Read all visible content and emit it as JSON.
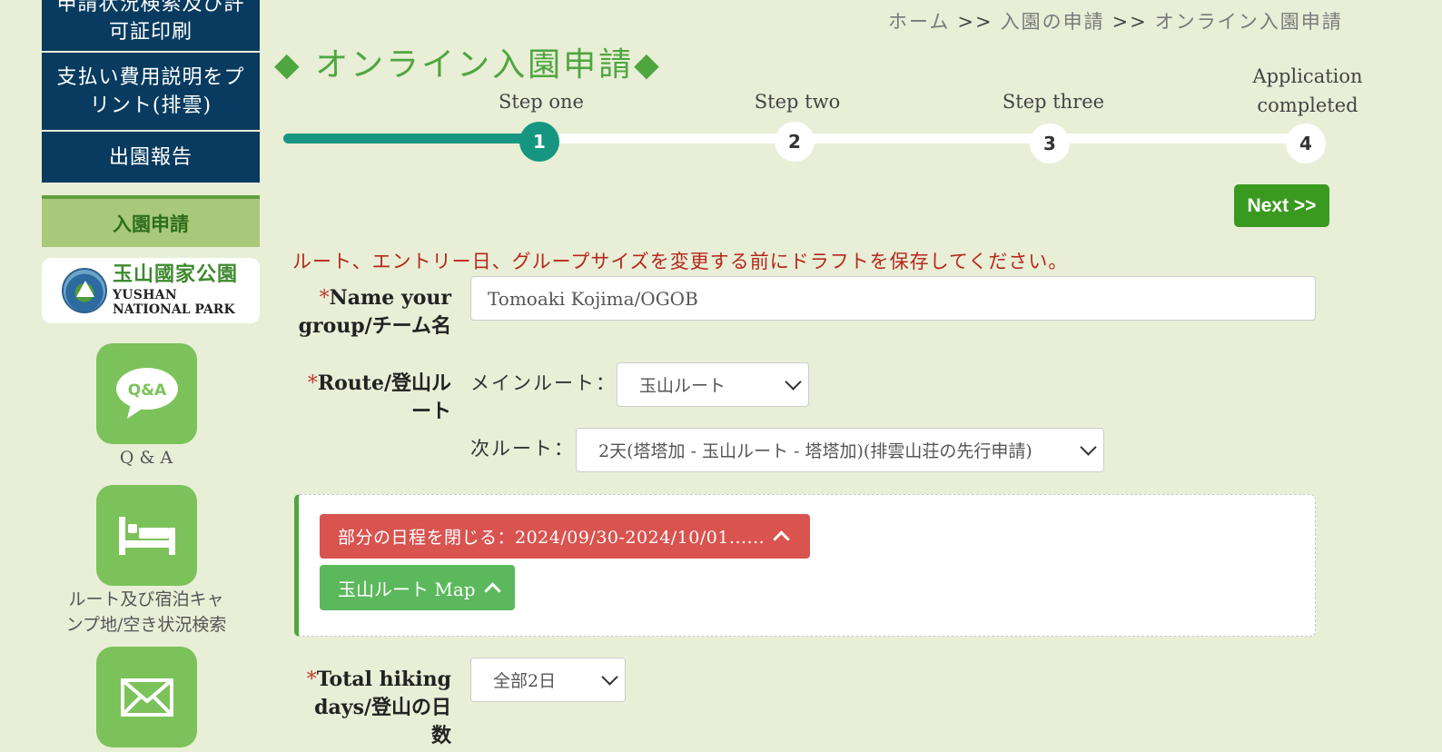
{
  "sidebar": {
    "nav": [
      {
        "label": "申請状況検索及び許可証印刷",
        "line1": "申請状況検索及び許",
        "line2": "可証印刷"
      },
      {
        "label": "支払い費用説明をプリント(排雲)",
        "line1": "支払い費用説明をプ",
        "line2": "リント(排雲)"
      },
      {
        "label": "出園報告"
      }
    ],
    "section_title": "入園申請",
    "logo": {
      "cn": "玉山國家公園",
      "en1": "YUSHAN",
      "en2": "NATIONAL PARK"
    },
    "tiles": [
      {
        "icon": "qa-chat-icon",
        "label": "Q & A",
        "bubble_text": "Q&A"
      },
      {
        "icon": "bed-icon",
        "label_line1": "ルート及び宿泊キャ",
        "label_line2": "ンプ地/空き状況検索"
      },
      {
        "icon": "envelope-icon"
      }
    ]
  },
  "breadcrumb": [
    "ホーム",
    "入園の申請",
    "オンライン入園申請"
  ],
  "breadcrumb_sep": ">>",
  "page_title": "◆ オンライン入園申請◆",
  "steps": [
    {
      "label": "Step one",
      "number": "1",
      "active": true
    },
    {
      "label": "Step two",
      "number": "2",
      "active": false
    },
    {
      "label": "Step three",
      "number": "3",
      "active": false
    },
    {
      "label_line1": "Application",
      "label_line2": "completed",
      "number": "4",
      "active": false
    }
  ],
  "progress_fraction": 0.25,
  "next_button": "Next >>",
  "warning": "ルート、エントリー日、グループサイズを変更する前にドラフトを保存してください。",
  "form": {
    "group_name": {
      "required": "*",
      "label_line1": "Name your",
      "label_line2": "group/チーム名",
      "value": "Tomoaki Kojima/OGOB"
    },
    "route": {
      "required": "*",
      "label_line1": "Route/登山ル",
      "label_line2": "ート",
      "main_label": "メインルート：",
      "main_value": "玉山ルート",
      "sub_label": "次ルート：",
      "sub_value": "2天(塔塔加 - 玉山ルート - 塔塔加)(排雲山荘の先行申請)"
    },
    "schedule_toggle": "部分の日程を閉じる：2024/09/30-2024/10/01......",
    "map_toggle": "玉山ルート Map",
    "hiking_days": {
      "required": "*",
      "label_line1": "Total hiking",
      "label_line2": "days/登山の日",
      "label_line3": "数",
      "value": "全部2日"
    }
  },
  "colors": {
    "navy": "#083b5f",
    "accent_green": "#4ea63f",
    "teal": "#169680",
    "danger": "#d9534f",
    "bg": "#e9eed7"
  }
}
